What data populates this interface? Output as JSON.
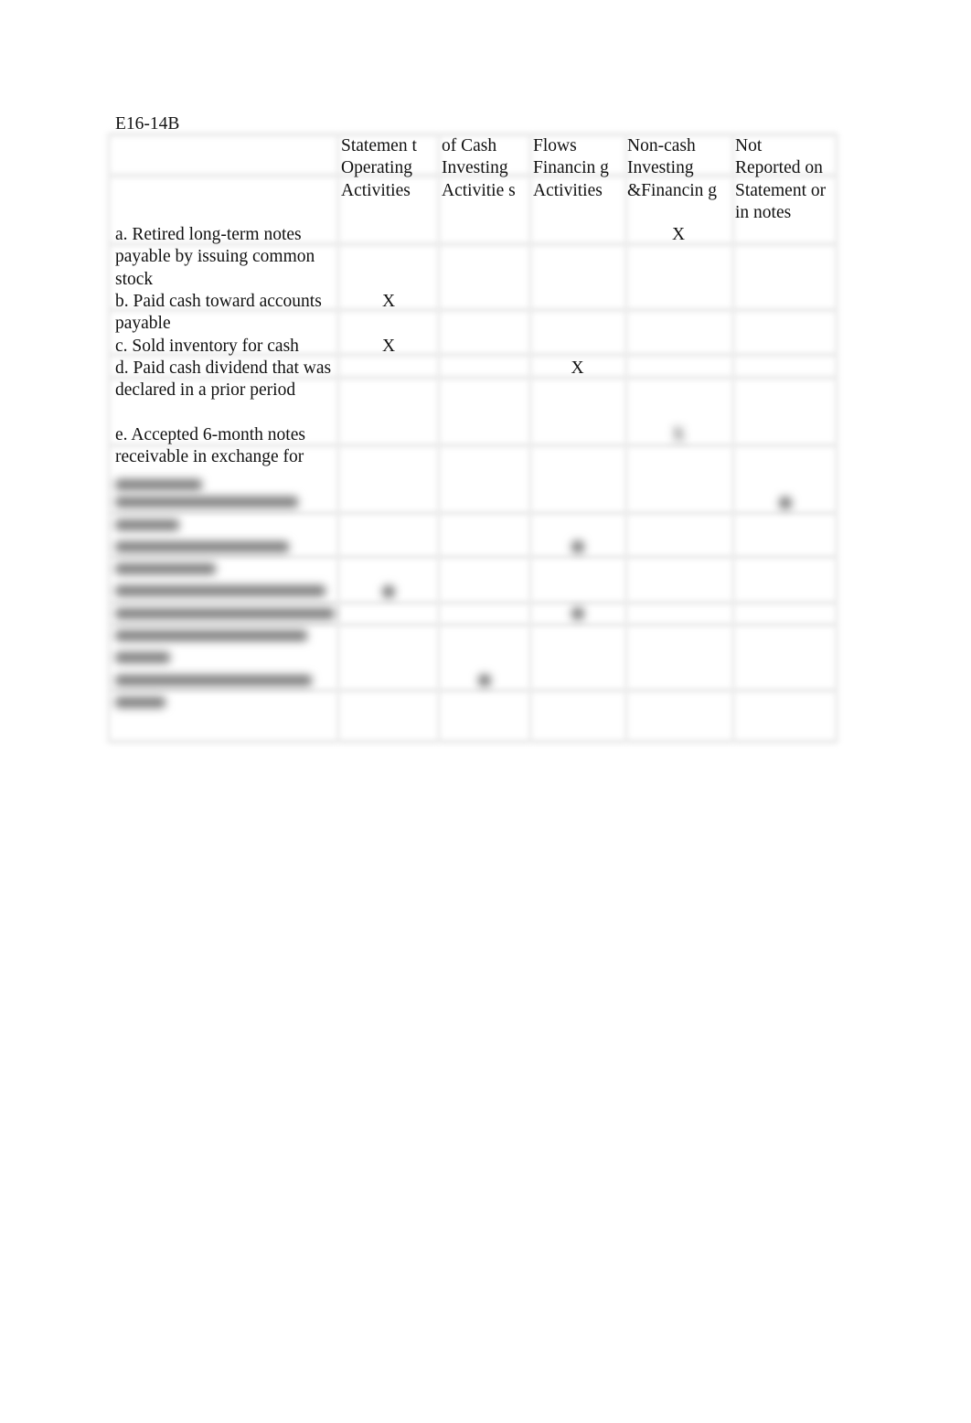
{
  "title": "E16-14B",
  "header": {
    "row1": [
      "",
      "Statemen t",
      "of Cash",
      "Flows",
      "Non-cash",
      "Not"
    ],
    "row2": [
      "",
      "Operating Activities",
      "Investing Activitie s",
      "Financin g Activities",
      "Investing &Financin g",
      "Reported on Statement or in notes"
    ]
  },
  "mark": "X",
  "rows": [
    {
      "label": "a. Retired long-term notes payable by issuing common stock",
      "col": 4,
      "lines": 3
    },
    {
      "label": "b. Paid cash toward accounts payable",
      "col": 1,
      "lines": 2
    },
    {
      "label": "c. Sold inventory for cash",
      "col": 1,
      "lines": 1
    },
    {
      "label": "d. Paid cash dividend that was declared in a prior period",
      "col": 3,
      "lines": 3
    },
    {
      "label": "e. Accepted 6-month notes receivable in exchange for",
      "col": 4,
      "lines": 3,
      "partially_blurred": true
    }
  ],
  "blurred_rows": [
    {
      "col": 5,
      "lines": 2
    },
    {
      "col": 3,
      "lines": 2
    },
    {
      "col": 1,
      "lines": 1
    },
    {
      "col": 3,
      "lines": 3
    },
    {
      "col": 2,
      "lines": 2
    }
  ]
}
